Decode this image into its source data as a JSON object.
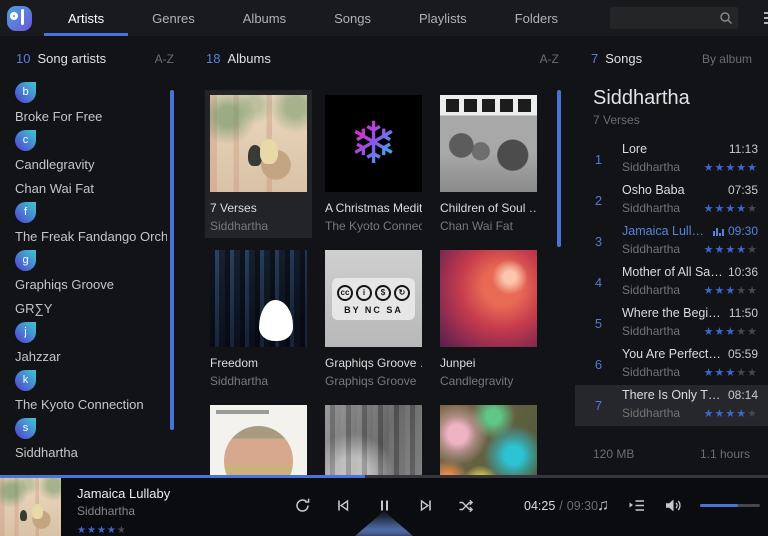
{
  "topbar": {
    "tabs": [
      {
        "label": "Artists",
        "active": true
      },
      {
        "label": "Genres",
        "active": false
      },
      {
        "label": "Albums",
        "active": false
      },
      {
        "label": "Songs",
        "active": false
      },
      {
        "label": "Playlists",
        "active": false
      },
      {
        "label": "Folders",
        "active": false
      }
    ],
    "search_placeholder": ""
  },
  "icons": {
    "minimize": "–",
    "maximize": "□",
    "close": "×",
    "star": "★",
    "snowflake": "❄",
    "note": "♫"
  },
  "artists_panel": {
    "count": "10",
    "title": "Song artists",
    "sort": "A-Z",
    "groups": [
      {
        "letter": "b",
        "artists": [
          "Broke For Free"
        ]
      },
      {
        "letter": "c",
        "artists": [
          "Candlegravity",
          "Chan Wai Fat"
        ]
      },
      {
        "letter": "f",
        "artists": [
          "The Freak Fandango Orchest…"
        ]
      },
      {
        "letter": "g",
        "artists": [
          "Graphiqs Groove",
          "GR∑Y"
        ]
      },
      {
        "letter": "j",
        "artists": [
          "Jahzzar"
        ]
      },
      {
        "letter": "k",
        "artists": [
          "The Kyoto Connection"
        ]
      },
      {
        "letter": "s",
        "artists": [
          "Siddhartha"
        ]
      }
    ]
  },
  "albums_panel": {
    "count": "18",
    "title": "Albums",
    "sort": "A-Z",
    "albums": [
      {
        "title": "7 Verses",
        "artist": "Siddhartha",
        "art": "verses",
        "selected": true
      },
      {
        "title": "A Christmas Medit…",
        "artist": "The Kyoto Connec…",
        "art": "snowflake",
        "selected": false
      },
      {
        "title": "Children of Soul …",
        "artist": "Chan Wai Fat",
        "art": "children",
        "selected": false
      },
      {
        "title": "Freedom",
        "artist": "Siddhartha",
        "art": "freedom",
        "selected": false
      },
      {
        "title": "Graphiqs Groove …",
        "artist": "Graphiqs Groove",
        "art": "cc",
        "selected": false
      },
      {
        "title": "Junpei",
        "artist": "Candlegravity",
        "art": "junpei",
        "selected": false
      },
      {
        "title": "",
        "artist": "",
        "art": "soundscapes",
        "selected": false
      },
      {
        "title": "",
        "artist": "",
        "art": "noise",
        "selected": false
      },
      {
        "title": "",
        "artist": "",
        "art": "flowers",
        "selected": false
      }
    ]
  },
  "cc_badge": {
    "glyphs": [
      "cc",
      "i",
      "$",
      "↻"
    ],
    "label": "BY NC SA"
  },
  "songs_panel": {
    "count": "7",
    "title": "Songs",
    "sort": "By album",
    "group_title": "Siddhartha",
    "group_subtitle": "7 Verses",
    "tracks": [
      {
        "no": "1",
        "title": "Lore",
        "duration": "11:13",
        "artist": "Siddhartha",
        "rating": 5,
        "playing": false,
        "selected": false
      },
      {
        "no": "2",
        "title": "Osho Baba",
        "duration": "07:35",
        "artist": "Siddhartha",
        "rating": 4,
        "playing": false,
        "selected": false
      },
      {
        "no": "3",
        "title": "Jamaica Lulla…",
        "duration": "09:30",
        "artist": "Siddhartha",
        "rating": 4,
        "playing": true,
        "selected": false
      },
      {
        "no": "4",
        "title": "Mother of All Saints",
        "duration": "10:36",
        "artist": "Siddhartha",
        "rating": 3,
        "playing": false,
        "selected": false
      },
      {
        "no": "5",
        "title": "Where the Beginni…",
        "duration": "11:50",
        "artist": "Siddhartha",
        "rating": 3,
        "playing": false,
        "selected": false
      },
      {
        "no": "6",
        "title": "You Are Perfect Be…",
        "duration": "05:59",
        "artist": "Siddhartha",
        "rating": 3,
        "playing": false,
        "selected": false
      },
      {
        "no": "7",
        "title": "There Is Only This …",
        "duration": "08:14",
        "artist": "Siddhartha",
        "rating": 4,
        "playing": false,
        "selected": true
      }
    ],
    "footer": {
      "size": "120 MB",
      "length": "1.1 hours"
    }
  },
  "player": {
    "track_title": "Jamaica Lullaby",
    "artist": "Siddhartha",
    "rating": 4,
    "time_current": "04:25",
    "time_separator": "/",
    "time_total": "09:30",
    "progress_percent": 47.5,
    "volume_percent": 63
  },
  "colors": {
    "accent": "#4a72d8",
    "star_filled": "#3e66cc",
    "playing_text": "#5b82dd"
  }
}
